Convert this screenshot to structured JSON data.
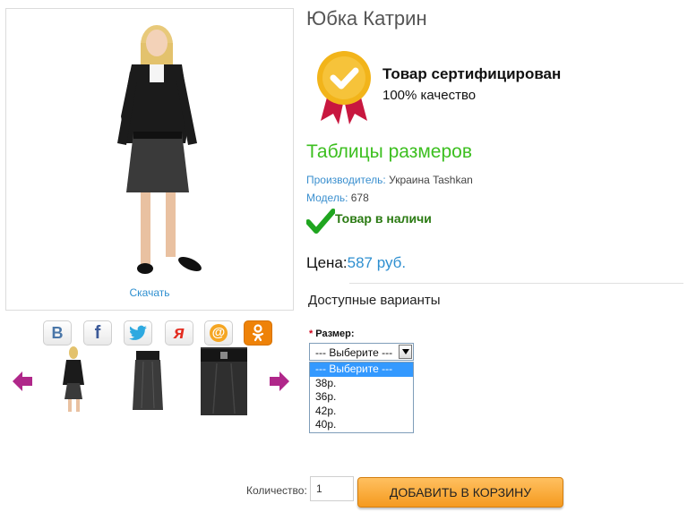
{
  "product": {
    "title": "Юбка Катрин",
    "download_link": "Скачать"
  },
  "certificate": {
    "title": "Товар сертифицирован",
    "subtitle": "100% качество"
  },
  "sizes_link": "Таблицы размеров",
  "meta": {
    "manufacturer_label": "Производитель:",
    "manufacturer_value": "Украина Tashkan",
    "model_label": "Модель:",
    "model_value": "678"
  },
  "stock": "Товар в наличи",
  "price": {
    "label": "Цена:",
    "value": "587 руб."
  },
  "variants_heading": "Доступные варианты",
  "size_field": {
    "required_mark": "*",
    "label": "Размер:",
    "selected": "--- Выберите ---",
    "options": [
      "--- Выберите ---",
      "38р.",
      "36р.",
      "42р.",
      "40р."
    ]
  },
  "social": [
    {
      "icon": "vk-icon",
      "glyph": "В",
      "color": "#4a76a8"
    },
    {
      "icon": "facebook-icon",
      "glyph": "f",
      "color": "#3b5998"
    },
    {
      "icon": "twitter-icon",
      "glyph": "🐦",
      "color": "#1da1f2"
    },
    {
      "icon": "yaru-icon",
      "glyph": "я",
      "color": "#e32c20"
    },
    {
      "icon": "mailru-icon",
      "glyph": "@",
      "color": "#f39c12"
    },
    {
      "icon": "odnoklassniki-icon",
      "glyph": "ок",
      "color": "#ee8208"
    }
  ],
  "quantity": {
    "label": "Количество:",
    "value": "1"
  },
  "cart_button": "ДОБАВИТЬ В КОРЗИНУ",
  "colors": {
    "accent_green": "#3cbf1f",
    "link_blue": "#2e8fd0",
    "cart_orange": "#f59a1f",
    "arrow_purple": "#b0278a"
  }
}
